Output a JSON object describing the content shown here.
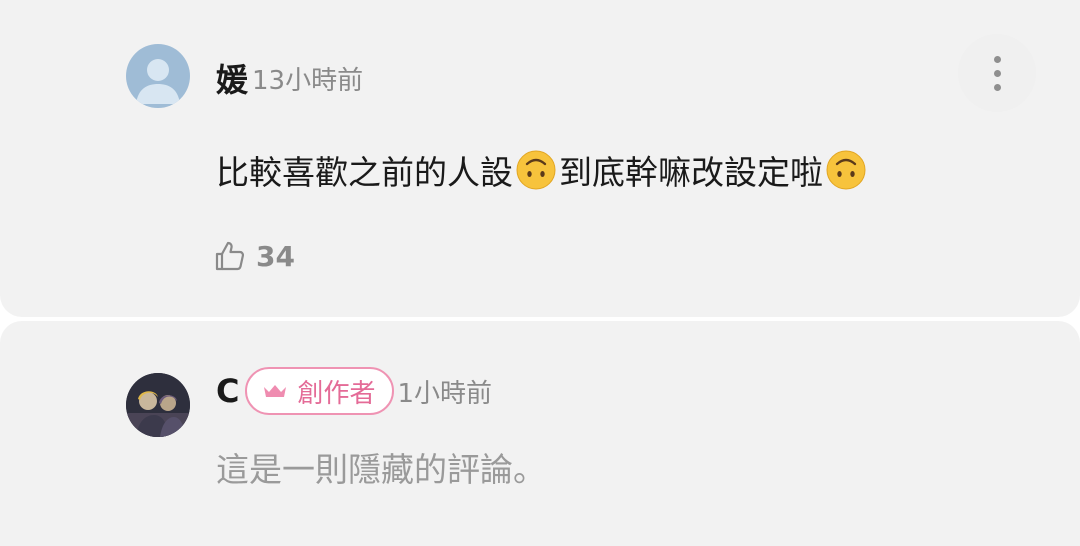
{
  "comments": [
    {
      "username": "媛",
      "time": "13小時前",
      "body_part1": "比較喜歡之前的人設",
      "emoji": "upside-down-face",
      "body_part2": "到底幹嘛改設定啦",
      "like_count": "34",
      "avatar": "default-user-avatar"
    },
    {
      "username": "C",
      "badge": "創作者",
      "badge_icon": "crown-icon",
      "time": "1小時前",
      "hidden_text": "這是一則隱藏的評論。",
      "avatar": "user-photo-avatar"
    }
  ],
  "colors": {
    "card_bg": "#f2f2f2",
    "badge_accent": "#e46b97",
    "muted_text": "#8a8a8a"
  }
}
